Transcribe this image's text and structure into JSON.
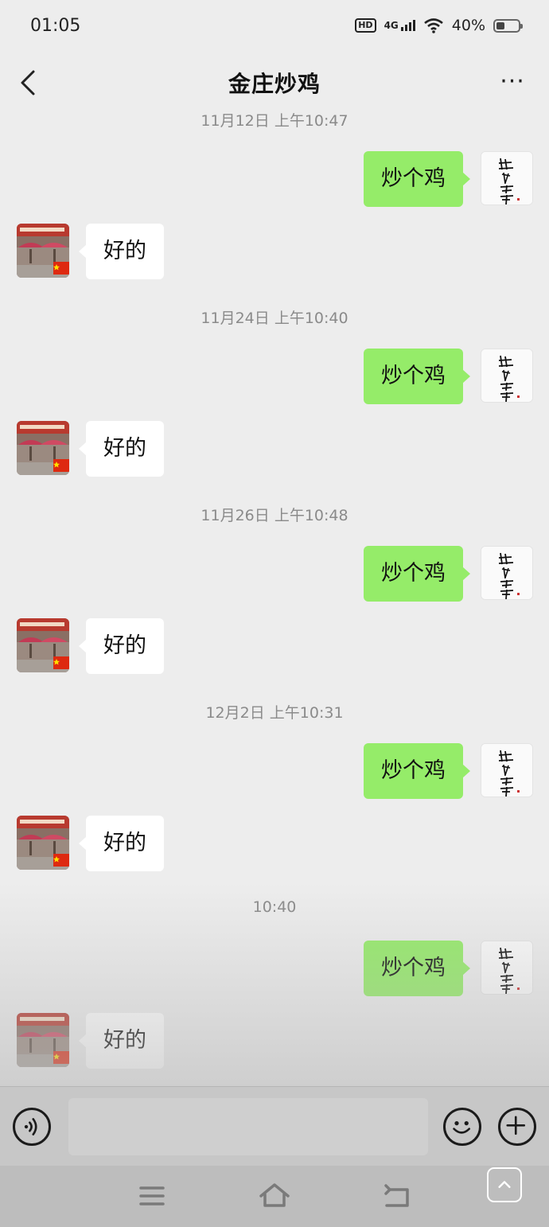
{
  "status_bar": {
    "time": "01:05",
    "hd": "HD",
    "network": "4G",
    "battery": "40%",
    "battery_level": 0.4
  },
  "header": {
    "title": "金庄炒鸡",
    "more_label": "···"
  },
  "timestamps": [
    "11月12日 上午10:47",
    "11月24日 上午10:40",
    "11月26日 上午10:48",
    "12月2日 上午10:31",
    "10:40"
  ],
  "messages": {
    "outgoing_text": "炒个鸡",
    "incoming_text": "好的"
  },
  "colors": {
    "outgoing_bubble": "#95ec69",
    "incoming_bubble": "#ffffff",
    "background": "#ededed"
  },
  "icons": {
    "back": "chevron-left-icon",
    "more": "more-dots-icon",
    "voice": "voice-icon",
    "emoji": "emoji-icon",
    "plus": "plus-icon",
    "nav_menu": "menu-icon",
    "nav_home": "home-icon",
    "nav_back": "back-icon",
    "scroll_up": "chevron-up-icon"
  }
}
